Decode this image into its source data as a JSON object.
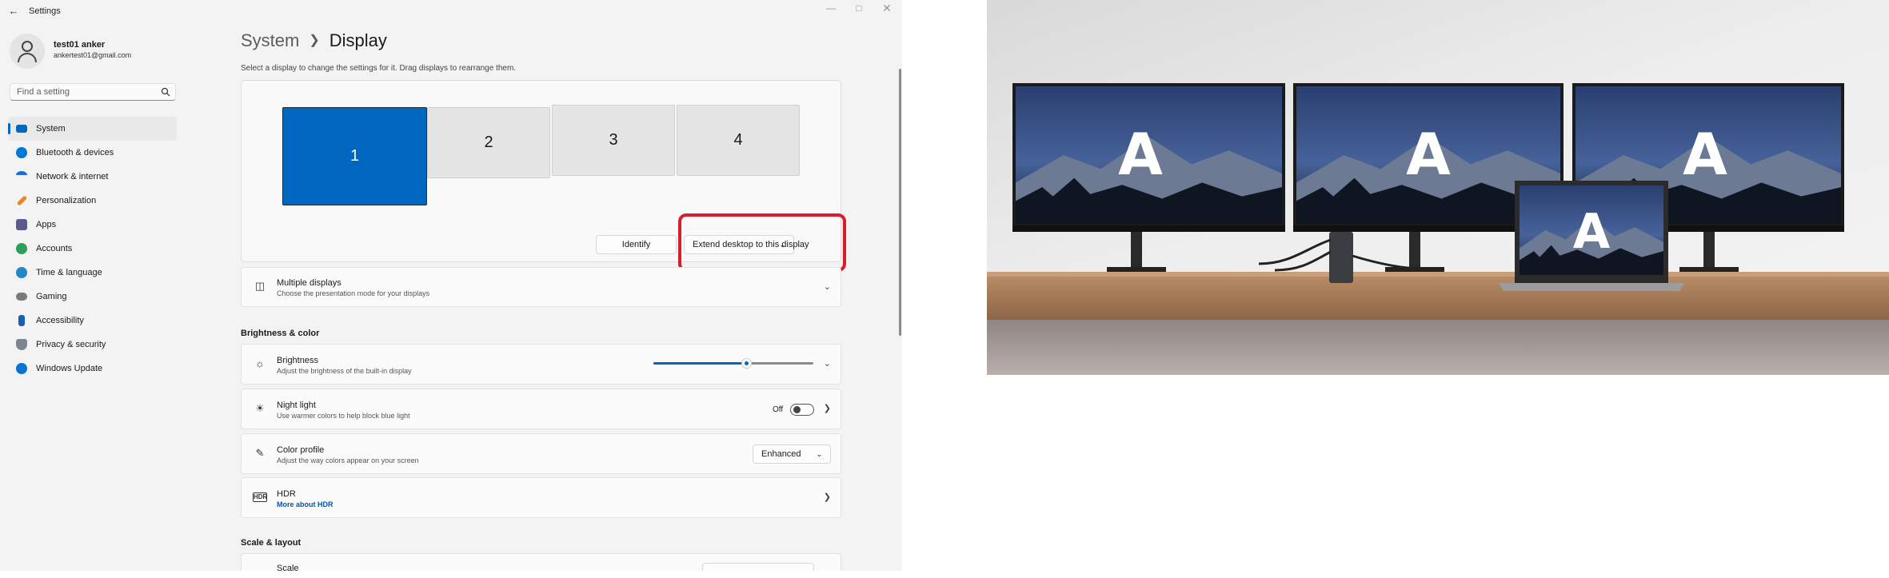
{
  "window": {
    "title": "Settings",
    "back_icon": "back-arrow-icon",
    "controls": [
      "minimize",
      "maximize",
      "close"
    ]
  },
  "profile": {
    "name": "test01 anker",
    "email": "ankertest01@gmail.com"
  },
  "search": {
    "placeholder": "Find a setting"
  },
  "nav": [
    {
      "label": "System",
      "icon": "system-icon",
      "color": "#0067c0",
      "selected": true
    },
    {
      "label": "Bluetooth & devices",
      "icon": "bluetooth-icon",
      "color": "#0078d4"
    },
    {
      "label": "Network & internet",
      "icon": "wifi-icon",
      "color": "#1e6bd6"
    },
    {
      "label": "Personalization",
      "icon": "brush-icon",
      "color": "#e08a2c"
    },
    {
      "label": "Apps",
      "icon": "apps-icon",
      "color": "#5a5a8c"
    },
    {
      "label": "Accounts",
      "icon": "accounts-icon",
      "color": "#2ba05a"
    },
    {
      "label": "Time & language",
      "icon": "globe-clock-icon",
      "color": "#1e88c9"
    },
    {
      "label": "Gaming",
      "icon": "gamepad-icon",
      "color": "#7a7a7a"
    },
    {
      "label": "Accessibility",
      "icon": "accessibility-icon",
      "color": "#1a5fb4"
    },
    {
      "label": "Privacy & security",
      "icon": "shield-icon",
      "color": "#7d8590"
    },
    {
      "label": "Windows Update",
      "icon": "update-icon",
      "color": "#0a74d6"
    }
  ],
  "breadcrumb": {
    "parent": "System",
    "current": "Display"
  },
  "arrange_hint": "Select a display to change the settings for it. Drag displays to rearrange them.",
  "monitors": [
    "1",
    "2",
    "3",
    "4"
  ],
  "selected_monitor": "1",
  "identify_label": "Identify",
  "extend_dropdown": "Extend desktop to this display",
  "multiple_displays": {
    "title": "Multiple displays",
    "subtitle": "Choose the presentation mode for your displays"
  },
  "brightness_section": "Brightness & color",
  "brightness": {
    "title": "Brightness",
    "subtitle": "Adjust the brightness of the built-in display",
    "level": 0.58
  },
  "night_light": {
    "title": "Night light",
    "subtitle": "Use warmer colors to help block blue light",
    "state": "Off"
  },
  "color_profile": {
    "title": "Color profile",
    "subtitle": "Adjust the way colors appear on your screen",
    "value": "Enhanced"
  },
  "hdr": {
    "title": "HDR",
    "link": "More about HDR"
  },
  "scale_section": "Scale & layout",
  "scale": {
    "title": "Scale"
  },
  "photo_overlay_letter": "A",
  "colors": {
    "accent": "#0067c0",
    "highlight_box": "#d81e2c"
  }
}
